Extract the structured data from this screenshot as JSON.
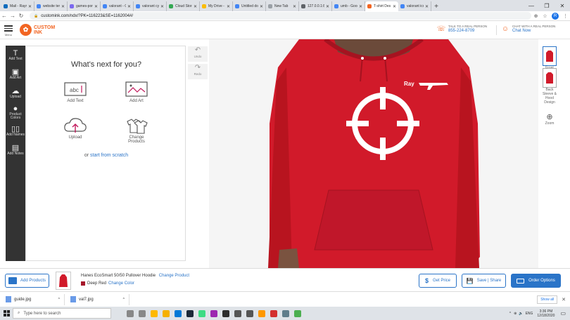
{
  "browser": {
    "tabs": [
      {
        "label": "Mail - Rayn",
        "color": "#0f6cbd"
      },
      {
        "label": "website tem",
        "color": "#4285f4"
      },
      {
        "label": "games-port",
        "color": "#7b68ee"
      },
      {
        "label": "valorant - G",
        "color": "#4285f4"
      },
      {
        "label": "valorant cyc",
        "color": "#4285f4"
      },
      {
        "label": "Cloud Stora",
        "color": "#34a853"
      },
      {
        "label": "My Drive - G",
        "color": "#fbbc04"
      },
      {
        "label": "Untitled do",
        "color": "#4285f4"
      },
      {
        "label": "New Tab",
        "color": "#9aa0a6"
      },
      {
        "label": "127.0.0.1:80",
        "color": "#5f6368"
      },
      {
        "label": "umb - Goog",
        "color": "#4285f4"
      },
      {
        "label": "T-shirt Des",
        "color": "#f26522",
        "active": true
      },
      {
        "label": "valorant ico",
        "color": "#4285f4"
      }
    ],
    "tab_close": "✕",
    "new_tab": "+",
    "window_controls": [
      "—",
      "❐",
      "✕"
    ],
    "url": "customink.com/ndx/?PK=116223&SE=1162004#/",
    "profile_initial": "R"
  },
  "site": {
    "menu_label": "Menu",
    "logo_line1": "CUSTOM",
    "logo_line2": "INK",
    "talk_label": "TALK TO A REAL PERSON",
    "phone": "855-224-8709",
    "chat_label": "CHAT WITH A REAL PERSON",
    "chat_now": "Chat Now"
  },
  "tools": [
    {
      "label": "Add Text",
      "icon": "T"
    },
    {
      "label": "Add Art",
      "icon": "▣"
    },
    {
      "label": "Upload",
      "icon": "☁"
    },
    {
      "label": "Product Colors",
      "icon": "●"
    },
    {
      "label": "Add Names",
      "icon": "▯▯"
    },
    {
      "label": "Add Notes",
      "icon": "▤"
    }
  ],
  "panel": {
    "title": "What's next for you?",
    "options": [
      {
        "label": "Add Text"
      },
      {
        "label": "Add Art"
      },
      {
        "label": "Upload"
      },
      {
        "label": "Change Products"
      }
    ],
    "scratch_prefix": "or ",
    "scratch_link": "start from scratch"
  },
  "history": {
    "undo": "Undo",
    "redo": "Redo"
  },
  "design": {
    "text": "Ray",
    "hoodie_color": "#d11a2a"
  },
  "views": [
    {
      "label": "Front"
    },
    {
      "label": "Back"
    },
    {
      "label": "Sleeve & Hood Design"
    },
    {
      "label": "Zoom"
    }
  ],
  "bottom": {
    "add_products": "Add Products",
    "product_name": "Hanes EcoSmart 50/50 Pullover Hoodie",
    "change_product": "Change Product",
    "color_name": "Deep Red",
    "change_color": "Change Color",
    "get_price": "Get Price",
    "save_share": "Save | Share",
    "order_options": "Order Options",
    "accent": "#2a74c8"
  },
  "downloads": {
    "files": [
      {
        "name": "guide.jpg"
      },
      {
        "name": "val7.jpg"
      }
    ],
    "show_all": "Show all"
  },
  "taskbar": {
    "search_placeholder": "Type here to search",
    "time": "3:36 PM",
    "date": "12/18/2020",
    "lang": "ENG"
  }
}
